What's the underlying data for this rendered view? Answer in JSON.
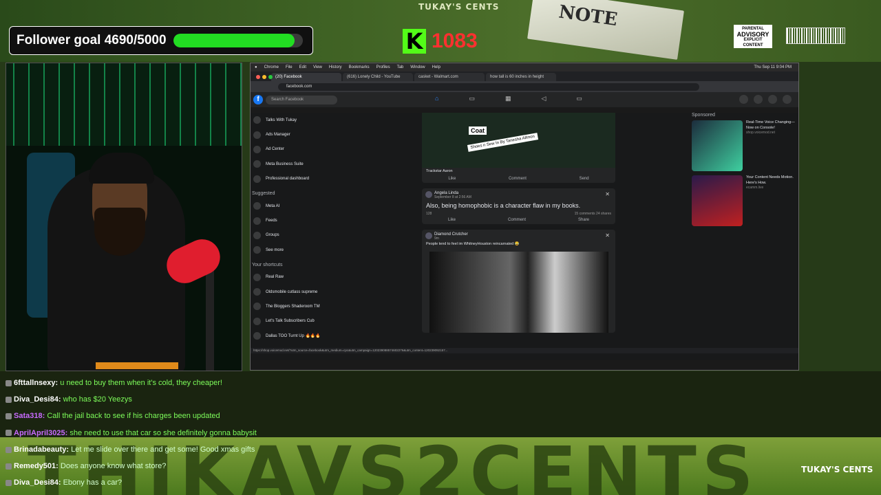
{
  "overlay": {
    "top_stamp": "TUKAY'S CENTS",
    "follower_label": "Follower goal 4690/5000",
    "follower_progress": 0.938,
    "kick_count": "1083",
    "banner_text": "THIKAVS2CENTS",
    "bottom_logo": "TUKAY'S CENTS",
    "advisory_title": "PARENTAL",
    "advisory_main": "ADVISORY",
    "advisory_sub": "EXPLICIT CONTENT",
    "money_text": "NOTE"
  },
  "browser": {
    "menu": [
      "Chrome",
      "File",
      "Edit",
      "View",
      "History",
      "Bookmarks",
      "Profiles",
      "Tab",
      "Window",
      "Help"
    ],
    "clock": "Thu Sep 11  9:04 PM",
    "tabs": [
      "(20) Facebook",
      "(616) Lonely Child - YouTube",
      "casket - Walmart.com",
      "how tall is 60 inches in height"
    ],
    "url": "facebook.com",
    "status_url": "https://shop.voicemod.net/?utm_source=facebook&utm_medium=cpc&utm_campaign=120239088574602276&utm_content=120239092157..."
  },
  "facebook": {
    "search_placeholder": "Search Facebook",
    "left_items": [
      "Talks With Tukay",
      "Ads Manager",
      "Ad Center",
      "Meta Business Suite",
      "Professional dashboard"
    ],
    "suggested_header": "Suggested",
    "suggested_items": [
      "Meta AI",
      "Feeds",
      "Groups",
      "See more"
    ],
    "shortcuts_header": "Your shortcuts",
    "shortcut_items": [
      "Real Raw",
      "Oldsmobile cutlass supreme",
      "The Bloggers Shaderoom TM",
      "Let's Talk Subscribers Cub",
      "Dallas TOO Turnt Up 🔥🔥🔥"
    ],
    "post1": {
      "coat": "Coat",
      "shoes": "Shoes n Sew In By Tanesha Allmon",
      "tags": "Trackstar   Aaron",
      "like": "Like",
      "comment": "Comment",
      "send": "Send"
    },
    "post2": {
      "author": "Angela Linda",
      "date": "September 8 at 2:56 AM",
      "text": "Also, being homophobic is a character flaw in my books.",
      "reactions": "128",
      "comments": "15 comments  24 shares",
      "like": "Like",
      "comment": "Comment",
      "share": "Share"
    },
    "post3": {
      "author": "Diamond Crutcher",
      "date": "9m",
      "text": "People tend to feel im WhitneyHouston reincarnated 😂"
    },
    "sponsored_header": "Sponsored",
    "ad1": {
      "title": "Real-Time Voice Changing—Now on Console!",
      "site": "shop.voicemod.net"
    },
    "ad2": {
      "title": "Your Content Needs Motion. Here's How.",
      "site": "ecamm.live"
    },
    "colors": {
      "blue": "#1877f2",
      "bg": "#18191a",
      "card": "#242526"
    }
  },
  "chat": [
    {
      "user": "6fttallnsexy",
      "text": "u need to buy them when it's cold, they cheaper!",
      "color": "#ffffff"
    },
    {
      "user": "Diva_Desi84",
      "text": "who has $20 Yeezys",
      "color": "#ffffff"
    },
    {
      "user": "Sata318",
      "text": "Call the jail back to see if his charges been updated",
      "color": "#c86bff"
    },
    {
      "user": "AprilApril3025",
      "text": "she need to use that car so she definitely gonna babysit",
      "color": "#c86bff"
    },
    {
      "user": "Brinadabeauty",
      "text": "Let me slide over there and get some! Good xmas gifts",
      "color": "#ffffff"
    },
    {
      "user": "Remedy501",
      "text": "Does anyone know what store?",
      "color": "#ffffff"
    },
    {
      "user": "Diva_Desi84",
      "text": "Ebony has a car?",
      "color": "#ffffff"
    }
  ]
}
